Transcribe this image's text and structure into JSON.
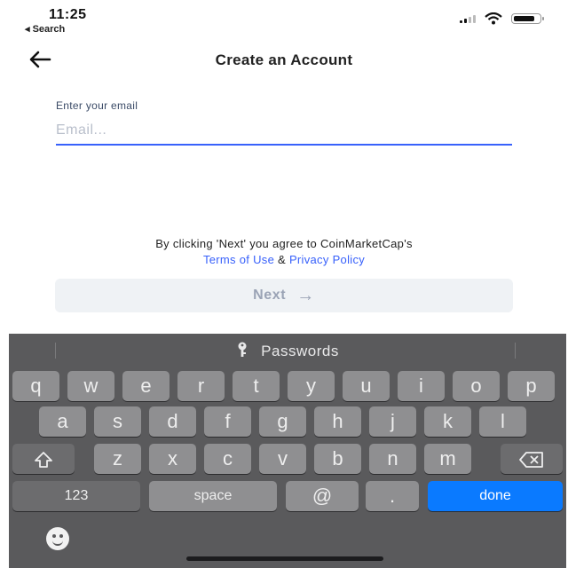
{
  "status_bar": {
    "time": "11:25",
    "back_app": "◂ Search",
    "battery_level_percent": 85
  },
  "nav": {
    "title": "Create an Account"
  },
  "form": {
    "email_label": "Enter your email",
    "email_placeholder": "Email...",
    "email_value": ""
  },
  "terms": {
    "prefix": "By clicking 'Next' you agree to CoinMarketCap's",
    "terms_link": "Terms of Use",
    "ampersand": "&",
    "privacy_link": "Privacy Policy"
  },
  "next_button": {
    "label": "Next",
    "arrow": "→"
  },
  "keyboard": {
    "suggestion": "Passwords",
    "row1": [
      "q",
      "w",
      "e",
      "r",
      "t",
      "y",
      "u",
      "i",
      "o",
      "p"
    ],
    "row2": [
      "a",
      "s",
      "d",
      "f",
      "g",
      "h",
      "j",
      "k",
      "l"
    ],
    "row3": [
      "z",
      "x",
      "c",
      "v",
      "b",
      "n",
      "m"
    ],
    "numbers_key": "123",
    "space_key": "space",
    "at_key": "@",
    "dot_key": ".",
    "done_key": "done"
  },
  "colors": {
    "accent": "#3861fb",
    "keyboard_bg": "#5a5a5c",
    "done_key": "#0a7aff"
  }
}
